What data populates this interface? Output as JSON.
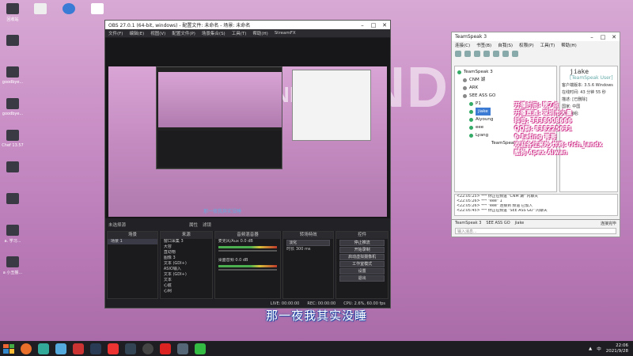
{
  "desktop": {
    "left_icons": [
      "回收站",
      "",
      "goodbye...",
      "goodbye...",
      "Chef 13.57",
      "",
      "",
      "a. 学习...",
      "a 小丑猴..."
    ],
    "top_icons": [
      "",
      "",
      ""
    ],
    "background_text": "ENDE"
  },
  "obs": {
    "title": "OBS 27.0.1 (64-bit, windows) - 配置文件: 未命名 - 场景: 未命名",
    "menu": [
      "文件(F)",
      "编辑(E)",
      "视图(V)",
      "配置文件(P)",
      "场景集合(S)",
      "工具(T)",
      "帮助(H)",
      "StreamFX"
    ],
    "toolbar_label": "未选择源",
    "toolbar_props": "属性",
    "toolbar_filters": "滤镜",
    "preview_subtitle": "那一夜我其实没睡",
    "docks": {
      "scenes": {
        "title": "场景",
        "items": [
          "场景 1"
        ]
      },
      "sources": {
        "title": "来源",
        "items": [
          "窗口采集 3",
          "大容",
          "直动物",
          "图像 3",
          "文本 (GDI+)",
          "ASIO输入",
          "文本 (GDI+)",
          "文本",
          "心脏",
          "心网"
        ]
      },
      "mixer": {
        "title": "音频混音器",
        "ch1": "麦克风/Aux",
        "ch2": "桌面音频",
        "db1": "0.0 dB",
        "db2": "0.0 dB"
      },
      "transitions": {
        "title": "转场特效",
        "type": "淡化",
        "duration_label": "时长",
        "duration": "300 ms"
      },
      "controls": {
        "title": "控件",
        "buttons": [
          "停止推流",
          "开始录制",
          "启动虚拟摄像机",
          "工作室模式",
          "设置",
          "退出"
        ]
      }
    },
    "status": {
      "live": "LIVE: 00:00:00",
      "rec": "REC: 00:00:00",
      "cpu": "CPU: 2.6%, 60.00 fps"
    }
  },
  "teamspeak": {
    "title": "TeamSpeak 3",
    "menu": [
      "连接(C)",
      "书签(B)",
      "自我(S)",
      "权限(P)",
      "工具(T)",
      "帮助(H)"
    ],
    "tree": [
      {
        "label": "TeamSpeak 3",
        "depth": 0
      },
      {
        "label": "CNM 湖",
        "depth": 1
      },
      {
        "label": "ARK",
        "depth": 1
      },
      {
        "label": "SEE ASS GO",
        "depth": 1
      },
      {
        "label": "P1",
        "depth": 2
      },
      {
        "label": "jiake",
        "depth": 2,
        "selected": true
      },
      {
        "label": "Aiyoung",
        "depth": 2
      },
      {
        "label": "eee",
        "depth": 2
      },
      {
        "label": "Lyang",
        "depth": 2
      },
      {
        "label": "TeamSpeak",
        "depth": 3
      }
    ],
    "info": {
      "name": "jiake",
      "tag": "[TeamSpeak User]",
      "rows": [
        "客户端版本: 3.5.6 Windows",
        "在线时间: 43 分钟 55 秒",
        "描述: [已删除]",
        "国家: 中国",
        "服务器组:"
      ]
    },
    "overlay": [
      "开播时间: 晚7点",
      "开播直通: 深圳市大量",
      "抖音: 3338008666",
      "QQ群: 838225631",
      "6-Eating 哥哥",
      "欢迎各位来吃 炸鸡: rich_landx",
      "酷狗 Apex Alwan"
    ],
    "log": [
      "<22:05:25> *** 你正在频道 \"CNM 湖\" 内聊天",
      "<22:05:26> *** \"eee\" 1",
      "<22:05:26> *** \"eee\" 连接到 频道 已加入",
      "<22:05:45> *** 你正在频道 \"SEE ASS GO\" 内聊天"
    ],
    "tabs": [
      "TeamSpeak 3",
      "SEE ASS GO",
      "jiake"
    ],
    "chat_placeholder": "输入消息...",
    "footer": "连接完毕"
  },
  "subtitle": "那一夜我其实没睡",
  "taskbar": {
    "time": "22:06",
    "date": "2021/9/28",
    "lang": "中"
  }
}
